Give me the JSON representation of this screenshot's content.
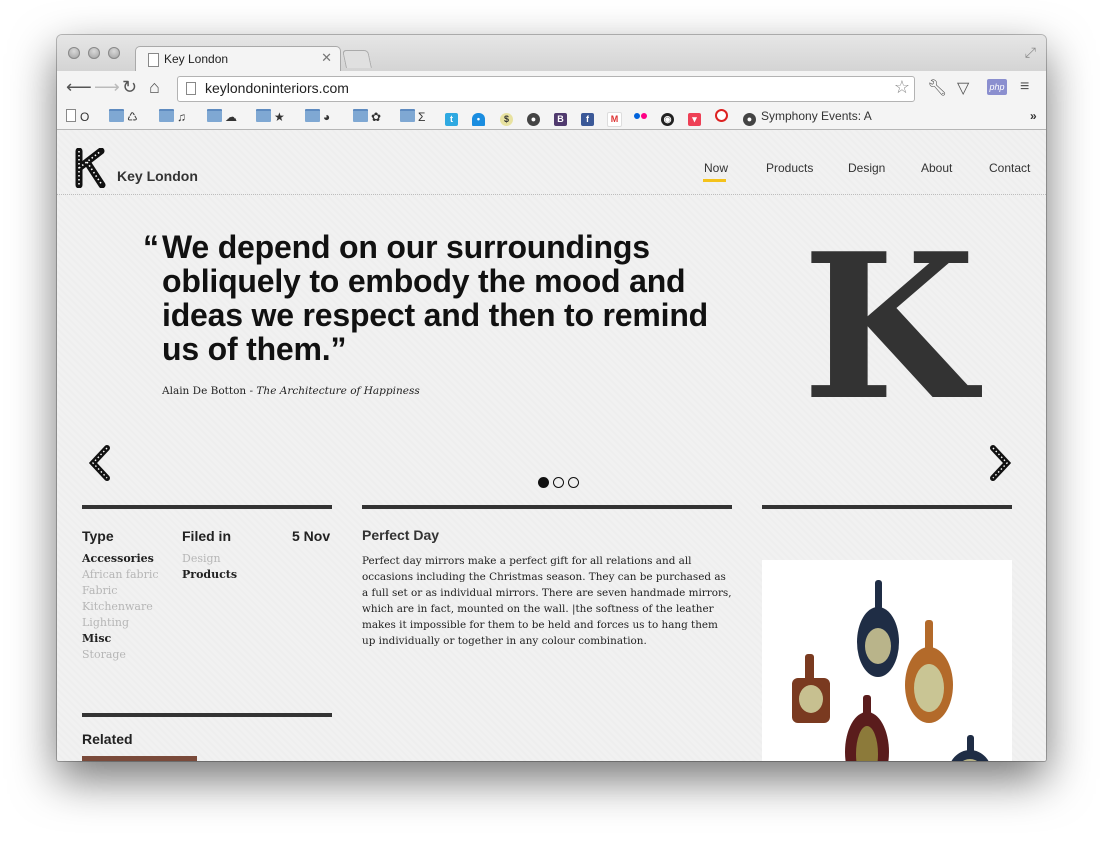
{
  "browser": {
    "tab_title": "Key London",
    "url": "keylondoninteriors.com",
    "bookmarks": [
      {
        "icon": "page-icon",
        "label": "O"
      },
      {
        "icon": "folder-icon",
        "label": "♺"
      },
      {
        "icon": "folder-icon",
        "label": "♫"
      },
      {
        "icon": "folder-icon",
        "label": "☁"
      },
      {
        "icon": "folder-icon",
        "label": "★"
      },
      {
        "icon": "folder-icon",
        "label": "◕"
      },
      {
        "icon": "folder-icon",
        "label": "✿"
      },
      {
        "icon": "folder-icon",
        "label": "Σ"
      },
      {
        "icon": "github-icon",
        "label": "Symphony Events: A"
      }
    ]
  },
  "site": {
    "name": "Key London",
    "nav": [
      {
        "label": "Now",
        "active": true
      },
      {
        "label": "Products"
      },
      {
        "label": "Design"
      },
      {
        "label": "About"
      },
      {
        "label": "Contact"
      }
    ]
  },
  "hero": {
    "open_quote": "“",
    "quote": "We depend on our surroundings obliquely to embody the mood and ideas we respect and then to remind us of them.”",
    "author": "Alain De Botton - ",
    "work": "The Architecture of Happiness",
    "big_letter": "K",
    "slide_index": 1,
    "slide_count": 3
  },
  "meta": {
    "type_heading": "Type",
    "filed_heading": "Filed in",
    "date": "5 Nov",
    "types": [
      {
        "label": "Accessories",
        "active": true
      },
      {
        "label": "African fabric",
        "active": false
      },
      {
        "label": "Fabric",
        "active": false
      },
      {
        "label": "Kitchenware",
        "active": false
      },
      {
        "label": "Lighting",
        "active": false
      },
      {
        "label": "Misc",
        "active": true
      },
      {
        "label": "Storage",
        "active": false
      }
    ],
    "filed": [
      {
        "label": "Design",
        "active": false
      },
      {
        "label": "Products",
        "active": true
      }
    ],
    "related_heading": "Related"
  },
  "article": {
    "title": "Perfect Day",
    "body": "Perfect day mirrors make a perfect gift for all relations and all occasions including the Christmas season. They can be purchased as a full set or as individual mirrors. There are seven handmade mirrors, which are in fact, mounted on the wall. |the softness of the leather makes it impossible for them to be held and forces us to hang them up individually or together in any colour combination."
  },
  "colors": {
    "accent": "#f4c21b",
    "text": "#222222",
    "muted": "#b6b6b6",
    "mirror_navy": "#1f2d45",
    "mirror_tan": "#b36a2a",
    "mirror_brown": "#7a3a20",
    "mirror_maroon": "#5a1c1c"
  }
}
